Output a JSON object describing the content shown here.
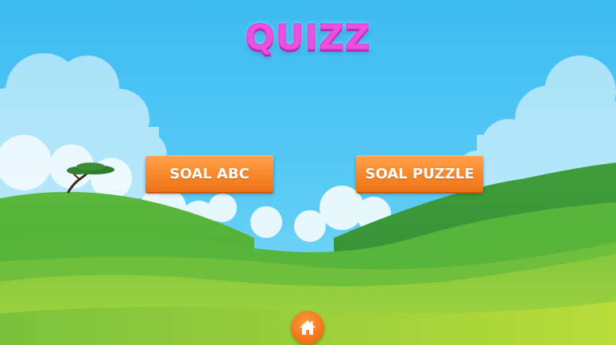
{
  "title": "QUIZZ",
  "buttons": {
    "soal_abc": "SOAL ABC",
    "soal_puzzle": "SOAL PUZZLE"
  },
  "icons": {
    "home": "home-icon"
  },
  "colors": {
    "sky_top": "#3ebef2",
    "title": "#f04ee0",
    "button": "#f8872b",
    "home_button": "#f5761d",
    "grass": "#5fb83a"
  }
}
